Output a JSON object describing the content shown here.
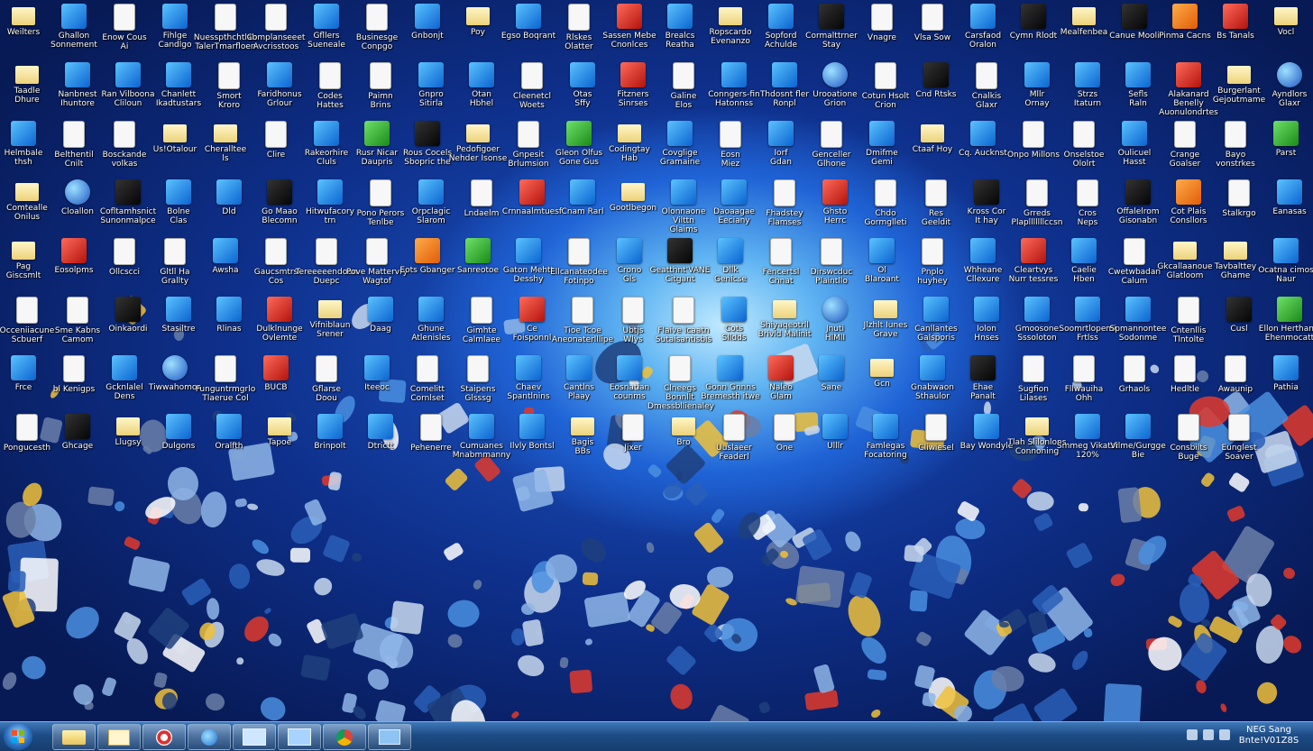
{
  "desktop": {
    "icons": [
      {
        "label": "Weilters",
        "kind": "folder"
      },
      {
        "label": "Ghallon\nSonnement",
        "kind": "app"
      },
      {
        "label": "Enow Cous\nAi",
        "kind": "doc"
      },
      {
        "label": "Fihlge\nCandlgo",
        "kind": "app"
      },
      {
        "label": "Nuesspthchtlah\nTalerTmarfloen",
        "kind": "doc"
      },
      {
        "label": "Complanseeet\nAvcrisstoos",
        "kind": "doc"
      },
      {
        "label": "Gfllers\nSueneale",
        "kind": "app"
      },
      {
        "label": "Businesge\nConpgo",
        "kind": "doc"
      },
      {
        "label": "Gnbonjt",
        "kind": "app"
      },
      {
        "label": "Poy",
        "kind": "folder"
      },
      {
        "label": "Egso Boqrant",
        "kind": "app"
      },
      {
        "label": "Rlskes\nOlatter",
        "kind": "doc"
      },
      {
        "label": "Sassen Mebe\nCnonlces",
        "kind": "red"
      },
      {
        "label": "Brealcs\nReatha",
        "kind": "app"
      },
      {
        "label": "Ropscardo\nEvenanzo",
        "kind": "folder"
      },
      {
        "label": "Sopford\nAchulde",
        "kind": "app"
      },
      {
        "label": "Cormalttrner\nStay",
        "kind": "dark"
      },
      {
        "label": "Vnagre",
        "kind": "doc"
      },
      {
        "label": "Vlsa Sow",
        "kind": "doc"
      },
      {
        "label": "Carsfaod\nOralon",
        "kind": "app"
      },
      {
        "label": "Cymn Rlodt",
        "kind": "dark"
      },
      {
        "label": "Mealfenbea",
        "kind": "folder"
      },
      {
        "label": "Canue Mooli",
        "kind": "dark"
      },
      {
        "label": "Pinma Cacns",
        "kind": "orange"
      },
      {
        "label": "Bs Tanals",
        "kind": "red"
      },
      {
        "label": "Vocl",
        "kind": "folder"
      },
      {
        "label": "Taadle\nDhure",
        "kind": "folder"
      },
      {
        "label": "Nanbnest\nIhuntore",
        "kind": "app"
      },
      {
        "label": "Ran Vilboona\nCliloun",
        "kind": "app"
      },
      {
        "label": "Chanlett\nIkadtustars",
        "kind": "app"
      },
      {
        "label": "Smort\nKroro",
        "kind": "doc"
      },
      {
        "label": "Faridhonus\nGrlour",
        "kind": "app"
      },
      {
        "label": "Codes\nHattes",
        "kind": "doc"
      },
      {
        "label": "Paimn\nBrins",
        "kind": "doc"
      },
      {
        "label": "Gnpro\nSitirla",
        "kind": "app"
      },
      {
        "label": "Otan\nHbhel",
        "kind": "app"
      },
      {
        "label": "Cleenetcl\nWoets",
        "kind": "doc"
      },
      {
        "label": "Otas\nSffy",
        "kind": "app"
      },
      {
        "label": "Fitzners\nSinrses",
        "kind": "red"
      },
      {
        "label": "Galine\nElos",
        "kind": "doc"
      },
      {
        "label": "Conngers-fin\nHatonnss",
        "kind": "app"
      },
      {
        "label": "Thdosnt fler\nRonpl",
        "kind": "app"
      },
      {
        "label": "Urooatione\nGrion",
        "kind": "round"
      },
      {
        "label": "Cotun Hsolt\nCrion",
        "kind": "doc"
      },
      {
        "label": "Cnd Rtsks",
        "kind": "dark"
      },
      {
        "label": "Cnalkis\nGlaxr",
        "kind": "doc"
      },
      {
        "label": "Mllr\nOrnay",
        "kind": "app"
      },
      {
        "label": "Strzs\nItaturn",
        "kind": "app"
      },
      {
        "label": "Sefls\nRaln",
        "kind": "app"
      },
      {
        "label": "Alakanard Benelly\nAuonulondrtes",
        "kind": "red"
      },
      {
        "label": "Burgerlant\nGejoutmame",
        "kind": "folder"
      },
      {
        "label": "Ayndlors\nGlaxr",
        "kind": "round"
      },
      {
        "label": "Helmbale\nthsh",
        "kind": "app"
      },
      {
        "label": "Belthentil\nCnilt",
        "kind": "doc"
      },
      {
        "label": "Bosckande\nvolkas",
        "kind": "doc"
      },
      {
        "label": "Us!Otalour",
        "kind": "folder"
      },
      {
        "label": "Cheralltee\nls",
        "kind": "folder"
      },
      {
        "label": "Clire",
        "kind": "doc"
      },
      {
        "label": "Rakeorhire\nCluls",
        "kind": "app"
      },
      {
        "label": "Rusr Nicar\nDaupris",
        "kind": "green"
      },
      {
        "label": "Rous Cocels\nSbopric the",
        "kind": "dark"
      },
      {
        "label": "Pedofigoer\nNehder Isonse",
        "kind": "folder"
      },
      {
        "label": "Gnpesit\nBrlumsion",
        "kind": "doc"
      },
      {
        "label": "Gleon Olfus\nGone Gus",
        "kind": "green"
      },
      {
        "label": "Codingtay\nHab",
        "kind": "folder"
      },
      {
        "label": "Covglige\nGramaine",
        "kind": "app"
      },
      {
        "label": "Eosn\nMiez",
        "kind": "doc"
      },
      {
        "label": "Iorf\nGdan",
        "kind": "app"
      },
      {
        "label": "Genceller\nGlhone",
        "kind": "doc"
      },
      {
        "label": "Dmifme\nGemi",
        "kind": "app"
      },
      {
        "label": "Ctaaf Hoy",
        "kind": "folder"
      },
      {
        "label": "Cq. Aucknst",
        "kind": "app"
      },
      {
        "label": "Onpo Millons",
        "kind": "doc"
      },
      {
        "label": "Onselstoe\nOlolrt",
        "kind": "doc"
      },
      {
        "label": "Oulicuel\nHasst",
        "kind": "app"
      },
      {
        "label": "Crange\nGoalser",
        "kind": "doc"
      },
      {
        "label": "Bayo\nvonstrkes",
        "kind": "doc"
      },
      {
        "label": "Parst",
        "kind": "green"
      },
      {
        "label": "Comtealle\nOnilus",
        "kind": "folder"
      },
      {
        "label": "Cloallon",
        "kind": "round"
      },
      {
        "label": "Cofltamhsnict\nSunonmalpce",
        "kind": "dark"
      },
      {
        "label": "Bolne\nClas",
        "kind": "app"
      },
      {
        "label": "Dld",
        "kind": "app"
      },
      {
        "label": "Go Maao\nBlecomn",
        "kind": "dark"
      },
      {
        "label": "Hitwufacory\ntrn",
        "kind": "app"
      },
      {
        "label": "Pono Perors\nTenlbe",
        "kind": "doc"
      },
      {
        "label": "Orpclagic\nSlarom",
        "kind": "app"
      },
      {
        "label": "Lndaelm",
        "kind": "doc"
      },
      {
        "label": "Crnnaalmtuesf",
        "kind": "red"
      },
      {
        "label": "Cnam Rarl",
        "kind": "app"
      },
      {
        "label": "Gootlbegon",
        "kind": "folder"
      },
      {
        "label": "Olonnaone Vilttn\nGlaims",
        "kind": "app"
      },
      {
        "label": "Daoaagae\nEeciany",
        "kind": "app"
      },
      {
        "label": "Fhadstey\nFlamses",
        "kind": "doc"
      },
      {
        "label": "Ghsto\nHerrc",
        "kind": "red"
      },
      {
        "label": "Chdo\nGormglleti",
        "kind": "doc"
      },
      {
        "label": "Res\nGeeldit",
        "kind": "doc"
      },
      {
        "label": "Kross Cor\nIt hay",
        "kind": "dark"
      },
      {
        "label": "Grreds\nPlaplllllllccsn",
        "kind": "doc"
      },
      {
        "label": "Cros\nNeps",
        "kind": "doc"
      },
      {
        "label": "Offalelrom\nGisonabn",
        "kind": "dark"
      },
      {
        "label": "Cot Plais\nConsllors",
        "kind": "orange"
      },
      {
        "label": "Stalkrgo",
        "kind": "doc"
      },
      {
        "label": "Eanasas",
        "kind": "app"
      },
      {
        "label": "Pag\nGiscsmlt",
        "kind": "folder"
      },
      {
        "label": "Eosolpms",
        "kind": "red"
      },
      {
        "label": "Ollcscci",
        "kind": "doc"
      },
      {
        "label": "Gltll Ha\nGrallty",
        "kind": "doc"
      },
      {
        "label": "Awsha",
        "kind": "app"
      },
      {
        "label": "Gaucsmtrs\nCos",
        "kind": "doc"
      },
      {
        "label": "Tereeeeendoon\nDuepc",
        "kind": "doc"
      },
      {
        "label": "Pove Mattervry\nWagtof",
        "kind": "doc"
      },
      {
        "label": "Eots Gbanger",
        "kind": "orange"
      },
      {
        "label": "Sanreotoe",
        "kind": "green"
      },
      {
        "label": "Gaton Mehtt\nDesshy",
        "kind": "app"
      },
      {
        "label": "Ellcanateodee\nFotinpo",
        "kind": "doc"
      },
      {
        "label": "Crono\nGls",
        "kind": "app"
      },
      {
        "label": "Geatthnt'VANE\nCitgant",
        "kind": "dark"
      },
      {
        "label": "Dllk\nGenicse",
        "kind": "app"
      },
      {
        "label": "Fencertsl\nChnat",
        "kind": "doc"
      },
      {
        "label": "Dirswcduc\nPlaintllo",
        "kind": "doc"
      },
      {
        "label": "Ol\nBlaroant",
        "kind": "app"
      },
      {
        "label": "Pnplo\nhuyhey",
        "kind": "doc"
      },
      {
        "label": "Whheane\nCllexure",
        "kind": "app"
      },
      {
        "label": "Cleartvys\nNurr tessres",
        "kind": "red"
      },
      {
        "label": "Caelie\nHben",
        "kind": "app"
      },
      {
        "label": "Cwetwbadan\nCalum",
        "kind": "doc"
      },
      {
        "label": "Gkcallaanoue\nGlatloom",
        "kind": "folder"
      },
      {
        "label": "Tavbalttey\nGhame",
        "kind": "folder"
      },
      {
        "label": "Ocatna cimos\nNaur",
        "kind": "app"
      },
      {
        "label": "Occeniiacune\nScbuerf",
        "kind": "doc"
      },
      {
        "label": "Sme Kabns\nCamom",
        "kind": "doc"
      },
      {
        "label": "Oinkaordi",
        "kind": "dark"
      },
      {
        "label": "Stasiltre",
        "kind": "app"
      },
      {
        "label": "Rlinas",
        "kind": "app"
      },
      {
        "label": "Dulklnunge\nOvlemte",
        "kind": "red"
      },
      {
        "label": "Vifniblaun\nSrener",
        "kind": "folder"
      },
      {
        "label": "Daag",
        "kind": "app"
      },
      {
        "label": "Ghune Atlenisles",
        "kind": "app"
      },
      {
        "label": "Gimhte\nCalmlaee",
        "kind": "doc"
      },
      {
        "label": "Ce\nFoisponnl",
        "kind": "red"
      },
      {
        "label": "Tioe Tcoe\nAneonaterlllipe",
        "kind": "doc"
      },
      {
        "label": "Ubtjs\nWlys",
        "kind": "doc"
      },
      {
        "label": "Flaive Icaatn\nSutaisantisbis",
        "kind": "doc"
      },
      {
        "label": "Cots\nSIldds",
        "kind": "app"
      },
      {
        "label": "Shiyaqeotrll\nBrivld Malinit",
        "kind": "folder"
      },
      {
        "label": "Jnuti\nHlMlI",
        "kind": "round"
      },
      {
        "label": "Jlzhlt Iunes\nGrave",
        "kind": "folder"
      },
      {
        "label": "Canllantes\nGalsporis",
        "kind": "app"
      },
      {
        "label": "Iolon\nHnses",
        "kind": "app"
      },
      {
        "label": "Gmoosone\nSssoloton",
        "kind": "app"
      },
      {
        "label": "Soomrtlopemi\nFrtlss",
        "kind": "app"
      },
      {
        "label": "Spmannontee\nSodonme",
        "kind": "app"
      },
      {
        "label": "Cntenllis\nTlntolte",
        "kind": "doc"
      },
      {
        "label": "Cusl",
        "kind": "dark"
      },
      {
        "label": "Ellon Herthanrt\nEhenmocatt",
        "kind": "green"
      },
      {
        "label": "Frce",
        "kind": "app"
      },
      {
        "label": "bl Kenigps",
        "kind": "doc"
      },
      {
        "label": "Gcknlalel\nDens",
        "kind": "app"
      },
      {
        "label": "Tiwwahomos",
        "kind": "round"
      },
      {
        "label": "Funguntrmgrlo Tlaerue Col",
        "kind": "doc"
      },
      {
        "label": "BUCB",
        "kind": "red"
      },
      {
        "label": "Gflarse\nDoou",
        "kind": "doc"
      },
      {
        "label": "Iteeoc",
        "kind": "app"
      },
      {
        "label": "Comelitt\nCornlset",
        "kind": "doc"
      },
      {
        "label": "Staipens\nGlsssg",
        "kind": "doc"
      },
      {
        "label": "Chaev\nSpantlnins",
        "kind": "app"
      },
      {
        "label": "Cantlns\nPlaay",
        "kind": "app"
      },
      {
        "label": "Eosnatian\ncounms",
        "kind": "app"
      },
      {
        "label": "Clneegs\nBonnllt\nDmessbllienaley",
        "kind": "doc"
      },
      {
        "label": "Gonn Gnnns\nBremesth itwe",
        "kind": "app"
      },
      {
        "label": "Naleo\nGlam",
        "kind": "red"
      },
      {
        "label": "Sane",
        "kind": "app"
      },
      {
        "label": "Gcn",
        "kind": "folder"
      },
      {
        "label": "Gnabwaon\nSthaulor",
        "kind": "app"
      },
      {
        "label": "Ehae\nPanalt",
        "kind": "dark"
      },
      {
        "label": "Sugfion\nLilases",
        "kind": "doc"
      },
      {
        "label": "Fllwauiha\nOhh",
        "kind": "doc"
      },
      {
        "label": "Grhaols",
        "kind": "doc"
      },
      {
        "label": "Hedltle",
        "kind": "doc"
      },
      {
        "label": "Awaunip",
        "kind": "doc"
      },
      {
        "label": "Pathia",
        "kind": "app"
      },
      {
        "label": "Pongucesth",
        "kind": "doc"
      },
      {
        "label": "Ghcage",
        "kind": "dark"
      },
      {
        "label": "Llugsy",
        "kind": "folder"
      },
      {
        "label": "Dulgons",
        "kind": "app"
      },
      {
        "label": "Oralfth",
        "kind": "app"
      },
      {
        "label": "Tapoe",
        "kind": "folder"
      },
      {
        "label": "Brinpolt",
        "kind": "app"
      },
      {
        "label": "Dtrictt",
        "kind": "app"
      },
      {
        "label": "Pehenerre",
        "kind": "doc"
      },
      {
        "label": "Cumuanes\nMnabmmanny",
        "kind": "app"
      },
      {
        "label": "Ilvly Bontsl",
        "kind": "app"
      },
      {
        "label": "Bagis\nBBs",
        "kind": "folder"
      },
      {
        "label": "Jixer",
        "kind": "doc"
      },
      {
        "label": "Bro",
        "kind": "folder"
      },
      {
        "label": "Uuslaeer\nFeaderl",
        "kind": "doc"
      },
      {
        "label": "One",
        "kind": "doc"
      },
      {
        "label": "Ulllr",
        "kind": "app"
      },
      {
        "label": "Famlegas\nFocatoring",
        "kind": "app"
      },
      {
        "label": "Cliwiesel",
        "kind": "doc"
      },
      {
        "label": "Bay Wondyle",
        "kind": "app"
      },
      {
        "label": "Tlah Slilonlons\nConnoning",
        "kind": "folder"
      },
      {
        "label": "Smmeg Vikatst\n120%",
        "kind": "app"
      },
      {
        "label": "Vilme/Gurgge\nBie",
        "kind": "app"
      },
      {
        "label": "Consbilts\nBuge",
        "kind": "doc"
      },
      {
        "label": "Eunglest\nSoaver",
        "kind": "doc"
      }
    ]
  },
  "taskbar": {
    "start_label": "Start",
    "pinned": [
      {
        "name": "taskbar-explorer",
        "icon": "folder-icon"
      },
      {
        "name": "taskbar-notes",
        "icon": "notepad-icon"
      },
      {
        "name": "taskbar-media",
        "icon": "media-icon"
      },
      {
        "name": "taskbar-browser-ie",
        "icon": "browser-icon"
      },
      {
        "name": "taskbar-window",
        "icon": "window-icon"
      },
      {
        "name": "taskbar-chrome",
        "icon": "chrome-icon"
      },
      {
        "name": "taskbar-app",
        "icon": "app-icon"
      }
    ],
    "clock": {
      "line1": "NEG Sang",
      "line2": "Bnte!V01Z8S"
    }
  },
  "colors": {
    "accent": "#1d63d6",
    "taskbar": "#1d4c86"
  }
}
